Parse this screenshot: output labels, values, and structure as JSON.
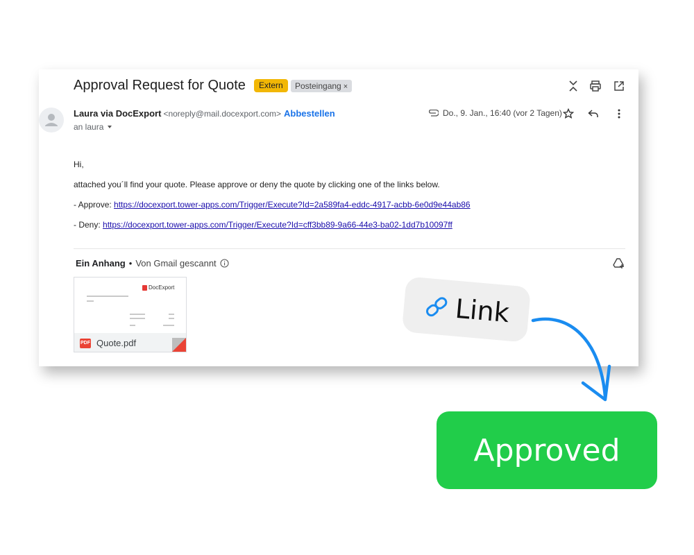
{
  "email": {
    "subject": "Approval Request for Quote",
    "labels": {
      "extern": "Extern",
      "inbox": "Posteingang",
      "inbox_remove": "×"
    },
    "sender": {
      "name": "Laura via DocExport",
      "email": "<noreply@mail.docexport.com>",
      "unsubscribe": "Abbestellen",
      "recipient": "an laura"
    },
    "date": "Do., 9. Jan., 16:40 (vor 2 Tagen)",
    "body": {
      "greeting": "Hi,",
      "intro": "attached you´ll find your quote. Please approve or deny the quote by clicking one of the links below.",
      "approve_prefix": "- Approve:",
      "approve_url": "https://docexport.tower-apps.com/Trigger/Execute?Id=2a589fa4-eddc-4917-acbb-6e0d9e44ab86",
      "deny_prefix": "- Deny:",
      "deny_url": "https://docexport.tower-apps.com/Trigger/Execute?Id=cff3bb89-9a66-44e3-ba02-1dd7b10097ff"
    },
    "attachments": {
      "title": "Ein Anhang",
      "separator": "•",
      "scan_note": "Von Gmail gescannt",
      "file_name": "Quote.pdf",
      "file_badge": "PDF",
      "thumbnail_brand": "DocExport"
    }
  },
  "overlay": {
    "link_label": "Link",
    "approved_label": "Approved"
  },
  "colors": {
    "extern_badge": "#f2b705",
    "link_blue": "#1a73e8",
    "approved_green": "#21cd4a",
    "arrow_blue": "#1a8cf0"
  },
  "icons": [
    "collapse-icon",
    "print-icon",
    "open-new-window-icon",
    "avatar-icon",
    "chevron-down-icon",
    "attachment-clip-icon",
    "star-icon",
    "reply-icon",
    "more-vert-icon",
    "info-icon",
    "drive-add-icon",
    "pdf-icon",
    "link-icon",
    "curved-arrow-icon"
  ]
}
